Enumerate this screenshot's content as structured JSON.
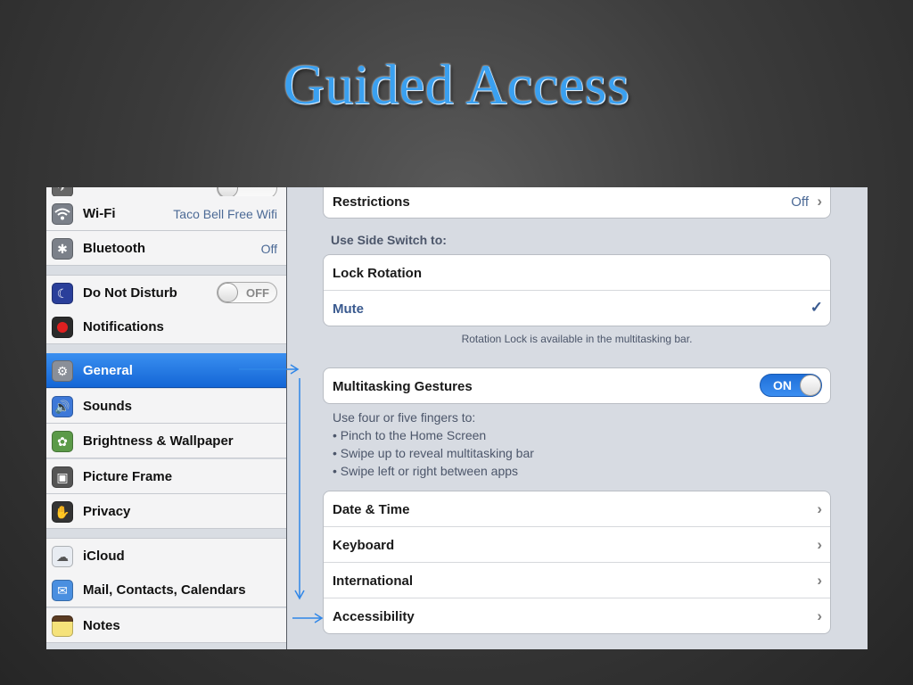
{
  "slide": {
    "title": "Guided Access"
  },
  "colors": {
    "accent_blue": "#2f86e8",
    "selected_row": "#1a6fe0",
    "detail_value": "#4c6a96"
  },
  "sidebar": {
    "items": [
      {
        "label": "Wi-Fi",
        "value": "Taco Bell Free Wifi",
        "icon": "wifi-icon"
      },
      {
        "label": "Bluetooth",
        "value": "Off",
        "icon": "bluetooth-icon"
      },
      {
        "label": "Do Not Disturb",
        "toggle": "OFF",
        "icon": "moon-icon"
      },
      {
        "label": "Notifications",
        "icon": "notifications-icon"
      },
      {
        "label": "General",
        "selected": true,
        "icon": "gear-icon"
      },
      {
        "label": "Sounds",
        "icon": "speaker-icon"
      },
      {
        "label": "Brightness & Wallpaper",
        "icon": "flower-icon"
      },
      {
        "label": "Picture Frame",
        "icon": "picture-frame-icon"
      },
      {
        "label": "Privacy",
        "icon": "hand-icon"
      },
      {
        "label": "iCloud",
        "icon": "cloud-icon"
      },
      {
        "label": "Mail, Contacts, Calendars",
        "icon": "mail-icon"
      },
      {
        "label": "Notes",
        "icon": "notepad-icon"
      }
    ]
  },
  "detail": {
    "restrictions": {
      "label": "Restrictions",
      "value": "Off"
    },
    "side_switch": {
      "header": "Use Side Switch to:",
      "options": [
        "Lock Rotation",
        "Mute"
      ],
      "selected": "Mute",
      "footer": "Rotation Lock is available in the multitasking bar."
    },
    "multitasking": {
      "label": "Multitasking Gestures",
      "toggle": "ON",
      "info": [
        "Use four or five fingers to:",
        "• Pinch to the Home Screen",
        "• Swipe up to reveal multitasking bar",
        "• Swipe left or right between apps"
      ]
    },
    "nav_items": [
      "Date & Time",
      "Keyboard",
      "International",
      "Accessibility"
    ]
  }
}
